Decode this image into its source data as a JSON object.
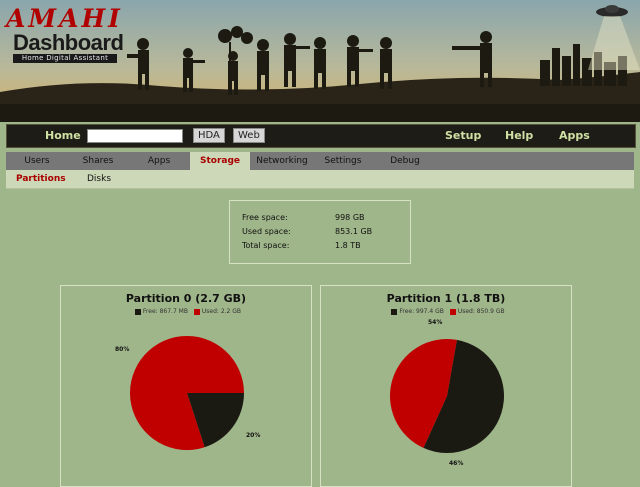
{
  "header": {
    "logo_title": "AMAHI",
    "logo_subtitle": "Dashboard",
    "logo_tagline": "Home Digital Assistant"
  },
  "topnav": {
    "home": "Home",
    "search_value": "",
    "hda_button": "HDA",
    "web_button": "Web",
    "setup": "Setup",
    "help": "Help",
    "apps": "Apps"
  },
  "tabs": [
    "Users",
    "Shares",
    "Apps",
    "Storage",
    "Networking",
    "Settings",
    "Debug"
  ],
  "active_tab": "Storage",
  "subtabs": [
    "Partitions",
    "Disks"
  ],
  "active_subtab": "Partitions",
  "summary": {
    "free_label": "Free space:",
    "free_value": "998 GB",
    "used_label": "Used space:",
    "used_value": "853.1 GB",
    "total_label": "Total space:",
    "total_value": "1.8 TB"
  },
  "colors": {
    "free": "#1a1a12",
    "used": "#c00000",
    "active_tab_text": "#a80000",
    "background": "#9fb58a"
  },
  "partitions": [
    {
      "title": "Partition 0 (2.7 GB)",
      "legend_free": "Free: 867.7 MB",
      "legend_used": "Used: 2.2 GB",
      "free_fraction": 0.2,
      "used_fraction": 0.8,
      "free_label": "20%",
      "used_label": "80%"
    },
    {
      "title": "Partition 1 (1.8 TB)",
      "legend_free": "Free: 997.4 GB",
      "legend_used": "Used: 850.9 GB",
      "free_fraction": 0.54,
      "used_fraction": 0.46,
      "free_label": "54%",
      "used_label": "46%"
    }
  ]
}
